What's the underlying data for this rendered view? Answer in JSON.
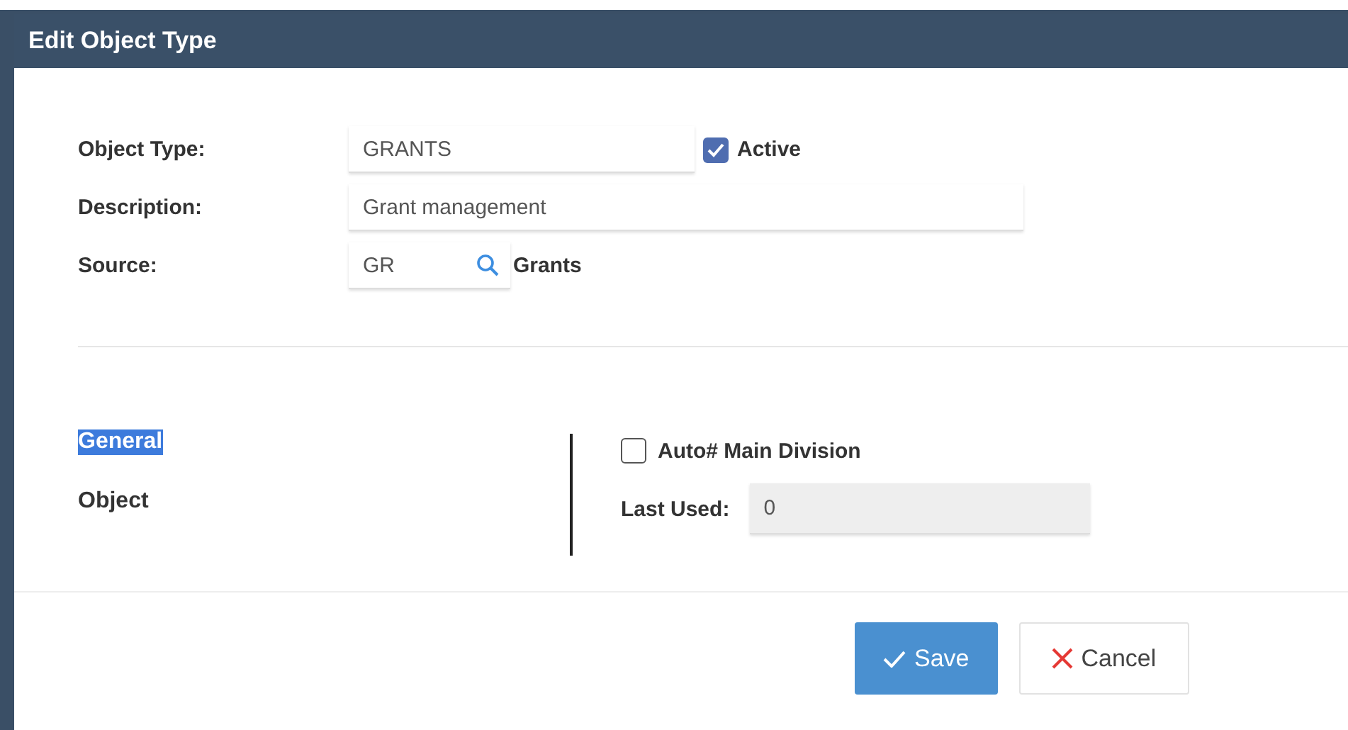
{
  "window": {
    "title": "Edit Object Type"
  },
  "fields": {
    "object_type": {
      "label": "Object Type:",
      "value": "GRANTS"
    },
    "active": {
      "label": "Active",
      "checked": true
    },
    "description": {
      "label": "Description:",
      "value": "Grant management"
    },
    "source": {
      "label": "Source:",
      "value": "GR",
      "name": "Grants"
    }
  },
  "sections": [
    {
      "label": "General",
      "selected": true
    },
    {
      "label": "Object",
      "selected": false
    }
  ],
  "auto_main_division": {
    "label": "Auto# Main Division",
    "checked": false
  },
  "last_used": {
    "label": "Last Used:",
    "value": "0",
    "disabled": true
  },
  "buttons": [
    {
      "kind": "save",
      "label": "Save"
    },
    {
      "kind": "cancel",
      "label": "Cancel"
    }
  ]
}
